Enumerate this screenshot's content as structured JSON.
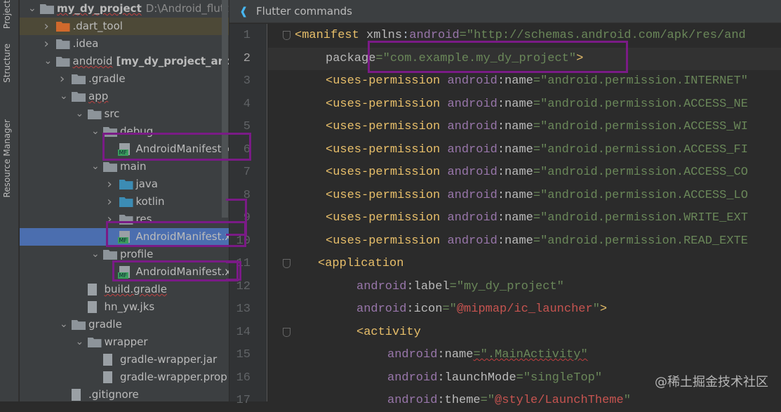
{
  "sidebar": {
    "tabs": [
      "Project",
      "Structure",
      "Resource Manager"
    ]
  },
  "tree": [
    {
      "level": 0,
      "arrow": "open",
      "icon": "project-folder",
      "text": "my_dy_project",
      "bold": true,
      "wavy": true,
      "path": "D:\\Android_flutte"
    },
    {
      "level": 1,
      "arrow": "closed",
      "icon": "folder-orange",
      "text": ".dart_tool",
      "highlight": true
    },
    {
      "level": 1,
      "arrow": "closed",
      "icon": "folder",
      "text": ".idea"
    },
    {
      "level": 1,
      "arrow": "open",
      "icon": "project-folder",
      "text": "android",
      "extra": "[my_dy_project_andr",
      "wavy": true
    },
    {
      "level": 2,
      "arrow": "closed",
      "icon": "folder",
      "text": ".gradle"
    },
    {
      "level": 2,
      "arrow": "open",
      "icon": "folder",
      "text": "app",
      "wavy": true
    },
    {
      "level": 3,
      "arrow": "open",
      "icon": "folder",
      "text": "src"
    },
    {
      "level": 4,
      "arrow": "open",
      "icon": "folder",
      "text": "debug"
    },
    {
      "level": 5,
      "icon": "manifest-file",
      "text": "AndroidManifest.x"
    },
    {
      "level": 4,
      "arrow": "open",
      "icon": "folder",
      "text": "main"
    },
    {
      "level": 5,
      "arrow": "closed",
      "icon": "folder-blue",
      "text": "java"
    },
    {
      "level": 5,
      "arrow": "closed",
      "icon": "folder-blue",
      "text": "kotlin"
    },
    {
      "level": 5,
      "arrow": "closed",
      "icon": "folder",
      "text": "res"
    },
    {
      "level": 5,
      "icon": "manifest-file",
      "text": "AndroidManifest.x",
      "selected": true
    },
    {
      "level": 4,
      "arrow": "open",
      "icon": "folder",
      "text": "profile"
    },
    {
      "level": 5,
      "icon": "manifest-file",
      "text": "AndroidManifest.x"
    },
    {
      "level": 3,
      "icon": "gradle-file",
      "text": "build.gradle",
      "wavy": true
    },
    {
      "level": 3,
      "icon": "file",
      "text": "hn_yw.jks"
    },
    {
      "level": 2,
      "arrow": "open",
      "icon": "folder",
      "text": "gradle"
    },
    {
      "level": 3,
      "arrow": "open",
      "icon": "folder",
      "text": "wrapper"
    },
    {
      "level": 4,
      "icon": "jar-file",
      "text": "gradle-wrapper.jar"
    },
    {
      "level": 4,
      "icon": "properties-file",
      "text": "gradle-wrapper.prop"
    },
    {
      "level": 2,
      "icon": "file",
      "text": ".gitignore"
    }
  ],
  "editor": {
    "header": "Flutter commands",
    "current_line": 2,
    "lines": [
      {
        "n": "1",
        "tokens": [
          [
            "tag",
            "<manifest"
          ],
          [
            "p",
            " "
          ],
          [
            "attr",
            "xmlns"
          ],
          [
            "p",
            ":"
          ],
          [
            "ns",
            "android"
          ],
          [
            "str",
            "=\"http://schemas.android.com/apk/res/and"
          ]
        ]
      },
      {
        "n": "2",
        "tokens": [
          [
            "attr",
            "package"
          ],
          [
            "str",
            "=\"com.example.my_dy_project\""
          ],
          [
            "tag",
            ">"
          ]
        ]
      },
      {
        "n": "3",
        "tokens": [
          [
            "tag",
            "<uses-permission "
          ],
          [
            "ns",
            "android"
          ],
          [
            "attr",
            ":name"
          ],
          [
            "str",
            "=\"android.permission.INTERNET\""
          ]
        ]
      },
      {
        "n": "4",
        "tokens": [
          [
            "tag",
            "<uses-permission "
          ],
          [
            "ns",
            "android"
          ],
          [
            "attr",
            ":name"
          ],
          [
            "str",
            "=\"android.permission.ACCESS_NE"
          ]
        ]
      },
      {
        "n": "5",
        "tokens": [
          [
            "tag",
            "<uses-permission "
          ],
          [
            "ns",
            "android"
          ],
          [
            "attr",
            ":name"
          ],
          [
            "str",
            "=\"android.permission.ACCESS_WI"
          ]
        ]
      },
      {
        "n": "6",
        "tokens": [
          [
            "tag",
            "<uses-permission "
          ],
          [
            "ns",
            "android"
          ],
          [
            "attr",
            ":name"
          ],
          [
            "str",
            "=\"android.permission.ACCESS_FI"
          ]
        ]
      },
      {
        "n": "7",
        "tokens": [
          [
            "tag",
            "<uses-permission "
          ],
          [
            "ns",
            "android"
          ],
          [
            "attr",
            ":name"
          ],
          [
            "str",
            "=\"android.permission.ACCESS_CO"
          ]
        ]
      },
      {
        "n": "8",
        "tokens": [
          [
            "tag",
            "<uses-permission "
          ],
          [
            "ns",
            "android"
          ],
          [
            "attr",
            ":name"
          ],
          [
            "str",
            "=\"android.permission.ACCESS_LO"
          ]
        ]
      },
      {
        "n": "9",
        "tokens": [
          [
            "tag",
            "<uses-permission "
          ],
          [
            "ns",
            "android"
          ],
          [
            "attr",
            ":name"
          ],
          [
            "str",
            "=\"android.permission.WRITE_EXT"
          ]
        ]
      },
      {
        "n": "10",
        "tokens": [
          [
            "tag",
            "<uses-permission "
          ],
          [
            "ns",
            "android"
          ],
          [
            "attr",
            ":name"
          ],
          [
            "str",
            "=\"android.permission.READ_EXTE"
          ]
        ]
      },
      {
        "n": "11",
        "tokens": [
          [
            "tag",
            "<application"
          ]
        ]
      },
      {
        "n": "12",
        "tokens": [
          [
            "ns",
            "android"
          ],
          [
            "attr",
            ":label"
          ],
          [
            "str",
            "=\"my_dy_project\""
          ]
        ]
      },
      {
        "n": "13",
        "tokens": [
          [
            "ns",
            "android"
          ],
          [
            "attr",
            ":icon"
          ],
          [
            "str",
            "=\""
          ],
          [
            "ref",
            "@mipmap/ic_launcher"
          ],
          [
            "str",
            "\""
          ],
          [
            "tag",
            ">"
          ]
        ]
      },
      {
        "n": "14",
        "tokens": [
          [
            "tag",
            "<activity"
          ]
        ]
      },
      {
        "n": "15",
        "tokens": [
          [
            "ns",
            "android"
          ],
          [
            "attr",
            ":name"
          ],
          [
            "str",
            "=\".MainActivity\""
          ]
        ]
      },
      {
        "n": "16",
        "tokens": [
          [
            "ns",
            "android"
          ],
          [
            "attr",
            ":launchMode"
          ],
          [
            "str",
            "=\"singleTop\""
          ]
        ]
      },
      {
        "n": "17",
        "tokens": [
          [
            "ns",
            "android"
          ],
          [
            "attr",
            ":theme"
          ],
          [
            "str",
            "=\""
          ],
          [
            "ref",
            "@style/LaunchTheme"
          ],
          [
            "str",
            "\""
          ]
        ]
      }
    ]
  },
  "watermark": "@稀土掘金技术社区"
}
